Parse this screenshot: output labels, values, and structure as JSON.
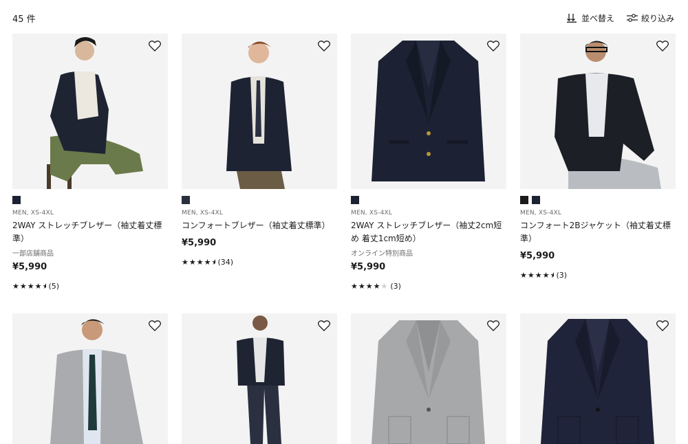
{
  "header": {
    "count": "45 件"
  },
  "toolbar": {
    "sort_label": "並べ替え",
    "filter_label": "絞り込み"
  },
  "colors": {
    "navy": "#1c2233",
    "dark": "#22262e",
    "bg": "#f3f3f3"
  },
  "products": [
    {
      "swatches": [
        "#1c2233"
      ],
      "meta": "MEN, XS-4XL",
      "name": "2WAY ストレッチブレザー（袖丈着丈標準）",
      "note": "一部店舗商品",
      "price": "¥5,990",
      "rating": 4.5,
      "reviews": "(5)"
    },
    {
      "swatches": [
        "#2a2f3d"
      ],
      "meta": "MEN, XS-4XL",
      "name": "コンフォートブレザー（袖丈着丈標準）",
      "note": "",
      "price": "¥5,990",
      "rating": 4.5,
      "reviews": "(34)"
    },
    {
      "swatches": [
        "#1c2233"
      ],
      "meta": "MEN, XS-4XL",
      "name": "2WAY ストレッチブレザー（袖丈2cm短め 着丈1cm短め）",
      "note": "オンライン特別商品",
      "price": "¥5,990",
      "rating": 4,
      "reviews": "(3)"
    },
    {
      "swatches": [
        "#1b1b1b",
        "#1c2233"
      ],
      "meta": "MEN, XS-4XL",
      "name": "コンフォート2Bジャケット（袖丈着丈標準）",
      "note": "",
      "price": "¥5,990",
      "rating": 4.5,
      "reviews": "(3)"
    },
    {
      "swatches": [],
      "meta": "",
      "name": "",
      "note": "",
      "price": "",
      "rating": 0,
      "reviews": ""
    },
    {
      "swatches": [],
      "meta": "",
      "name": "",
      "note": "",
      "price": "",
      "rating": 0,
      "reviews": ""
    },
    {
      "swatches": [],
      "meta": "",
      "name": "",
      "note": "",
      "price": "",
      "rating": 0,
      "reviews": ""
    },
    {
      "swatches": [],
      "meta": "",
      "name": "",
      "note": "",
      "price": "",
      "rating": 0,
      "reviews": ""
    }
  ],
  "icons": {
    "favorite": "heart-outline-icon",
    "sort": "sort-arrows-icon",
    "filter": "sliders-icon"
  }
}
